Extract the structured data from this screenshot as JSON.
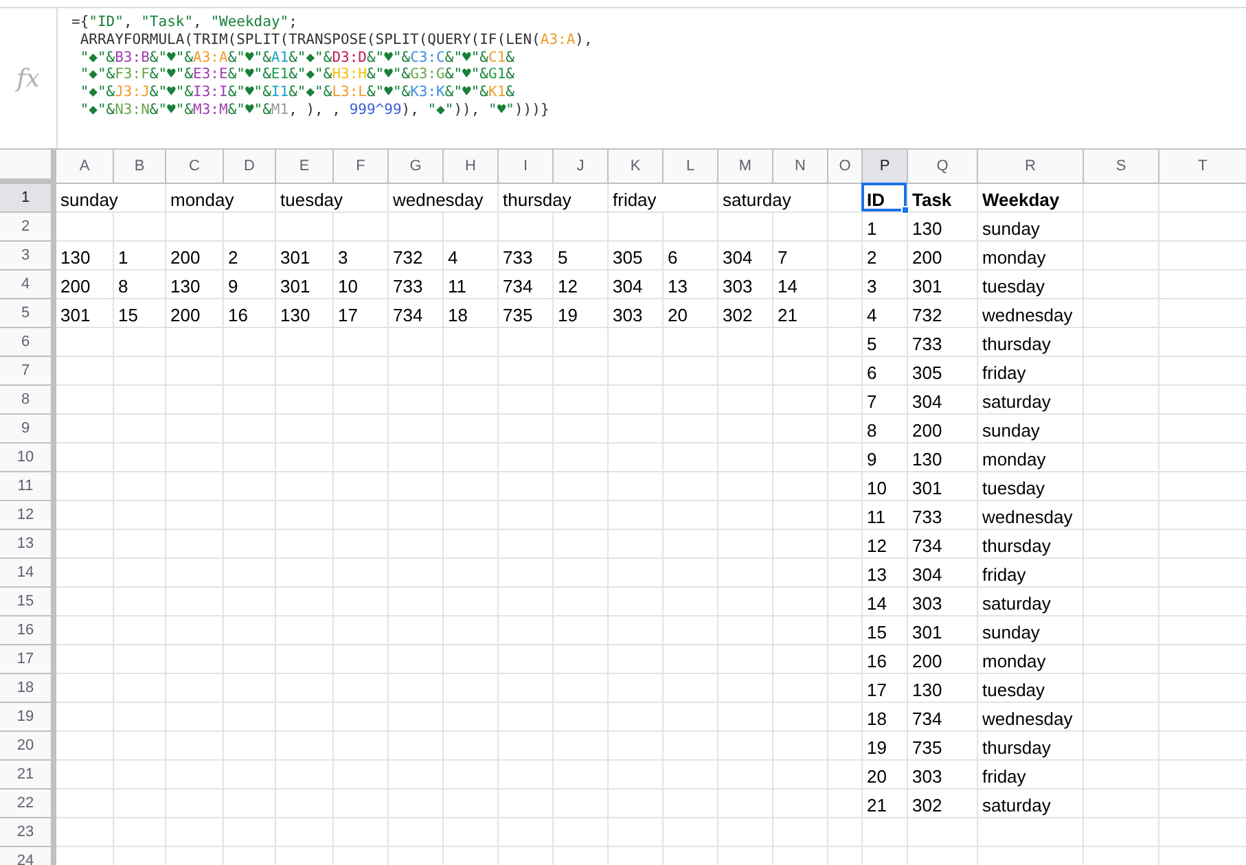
{
  "formula_bar": {
    "icon_label": "fx",
    "lines": [
      [
        {
          "text": "={",
          "color": "#333333"
        },
        {
          "text": "\"ID\"",
          "color": "#188038"
        },
        {
          "text": ", ",
          "color": "#333333"
        },
        {
          "text": "\"Task\"",
          "color": "#188038"
        },
        {
          "text": ", ",
          "color": "#333333"
        },
        {
          "text": "\"Weekday\"",
          "color": "#188038"
        },
        {
          "text": ";",
          "color": "#333333"
        }
      ],
      [
        {
          "text": " ARRAYFORMULA(TRIM(SPLIT(TRANSPOSE(SPLIT(QUERY(IF(LEN(",
          "color": "#333333"
        },
        {
          "text": "A3:A",
          "color": "#f09d2a"
        },
        {
          "text": "),",
          "color": "#333333"
        }
      ],
      [
        {
          "text": " \"◆\"&",
          "color": "#188038"
        },
        {
          "text": "B3:B",
          "color": "#a142b4"
        },
        {
          "text": "&\"♥\"&",
          "color": "#188038"
        },
        {
          "text": "A3:A",
          "color": "#f09d2a"
        },
        {
          "text": "&\"♥\"&",
          "color": "#188038"
        },
        {
          "text": "A1",
          "color": "#1aa3c9"
        },
        {
          "text": "&\"◆\"&",
          "color": "#188038"
        },
        {
          "text": "D3:D",
          "color": "#c2185b"
        },
        {
          "text": "&\"♥\"&",
          "color": "#188038"
        },
        {
          "text": "C3:C",
          "color": "#3b8ee0"
        },
        {
          "text": "&\"♥\"&",
          "color": "#188038"
        },
        {
          "text": "C1",
          "color": "#f09d2a"
        },
        {
          "text": "&",
          "color": "#188038"
        }
      ],
      [
        {
          "text": " \"◆\"&",
          "color": "#188038"
        },
        {
          "text": "F3:F",
          "color": "#6aa84f"
        },
        {
          "text": "&\"♥\"&",
          "color": "#188038"
        },
        {
          "text": "E3:E",
          "color": "#a142b4"
        },
        {
          "text": "&\"♥\"&",
          "color": "#188038"
        },
        {
          "text": "E1",
          "color": "#1e9e4a"
        },
        {
          "text": "&\"◆\"&",
          "color": "#188038"
        },
        {
          "text": "H3:H",
          "color": "#f4c20d"
        },
        {
          "text": "&\"♥\"&",
          "color": "#188038"
        },
        {
          "text": "G3:G",
          "color": "#6aa84f"
        },
        {
          "text": "&\"♥\"&",
          "color": "#188038"
        },
        {
          "text": "G1",
          "color": "#1e9e4a"
        },
        {
          "text": "&",
          "color": "#188038"
        }
      ],
      [
        {
          "text": " \"◆\"&",
          "color": "#188038"
        },
        {
          "text": "J3:J",
          "color": "#f09d2a"
        },
        {
          "text": "&\"♥\"&",
          "color": "#188038"
        },
        {
          "text": "I3:I",
          "color": "#a142b4"
        },
        {
          "text": "&\"♥\"&",
          "color": "#188038"
        },
        {
          "text": "I1",
          "color": "#1aa3c9"
        },
        {
          "text": "&\"◆\"&",
          "color": "#188038"
        },
        {
          "text": "L3:L",
          "color": "#f09d2a"
        },
        {
          "text": "&\"♥\"&",
          "color": "#188038"
        },
        {
          "text": "K3:K",
          "color": "#3b8ee0"
        },
        {
          "text": "&\"♥\"&",
          "color": "#188038"
        },
        {
          "text": "K1",
          "color": "#f09d2a"
        },
        {
          "text": "&",
          "color": "#188038"
        }
      ],
      [
        {
          "text": " \"◆\"&",
          "color": "#188038"
        },
        {
          "text": "N3:N",
          "color": "#6aa84f"
        },
        {
          "text": "&\"♥\"&",
          "color": "#188038"
        },
        {
          "text": "M3:M",
          "color": "#a142b4"
        },
        {
          "text": "&\"♥\"&",
          "color": "#188038"
        },
        {
          "text": "M1",
          "color": "#999999"
        },
        {
          "text": ", ), , ",
          "color": "#333333"
        },
        {
          "text": "999^99",
          "color": "#3b5fd6"
        },
        {
          "text": "), ",
          "color": "#333333"
        },
        {
          "text": "\"◆\"",
          "color": "#188038"
        },
        {
          "text": ")), ",
          "color": "#333333"
        },
        {
          "text": "\"♥\"",
          "color": "#188038"
        },
        {
          "text": ")))}",
          "color": "#333333"
        }
      ]
    ]
  },
  "columns": [
    {
      "label": "A",
      "selected": false
    },
    {
      "label": "B",
      "selected": false
    },
    {
      "label": "C",
      "selected": false
    },
    {
      "label": "D",
      "selected": false
    },
    {
      "label": "E",
      "selected": false
    },
    {
      "label": "F",
      "selected": false
    },
    {
      "label": "G",
      "selected": false
    },
    {
      "label": "H",
      "selected": false
    },
    {
      "label": "I",
      "selected": false
    },
    {
      "label": "J",
      "selected": false
    },
    {
      "label": "K",
      "selected": false
    },
    {
      "label": "L",
      "selected": false
    },
    {
      "label": "M",
      "selected": false
    },
    {
      "label": "N",
      "selected": false
    },
    {
      "label": "O",
      "selected": false
    },
    {
      "label": "P",
      "selected": true
    },
    {
      "label": "Q",
      "selected": false
    },
    {
      "label": "R",
      "selected": false
    },
    {
      "label": "S",
      "selected": false
    },
    {
      "label": "T",
      "selected": false
    }
  ],
  "rows": [
    {
      "number": "1",
      "selected": true,
      "cells": [
        "sunday",
        null,
        "monday",
        null,
        "tuesday",
        null,
        "wednesday",
        null,
        "thursday",
        null,
        "friday",
        null,
        "saturday",
        null,
        null,
        {
          "text": "ID",
          "bold": true,
          "selected": true
        },
        {
          "text": "Task",
          "bold": true,
          "selected": false
        },
        {
          "text": "Weekday",
          "bold": true,
          "selected": false
        },
        null,
        null
      ]
    },
    {
      "number": "2",
      "selected": false,
      "cells": [
        null,
        null,
        null,
        null,
        null,
        null,
        null,
        null,
        null,
        null,
        null,
        null,
        null,
        null,
        null,
        "1",
        "130",
        "sunday",
        null,
        null
      ]
    },
    {
      "number": "3",
      "selected": false,
      "cells": [
        "130",
        "1",
        "200",
        "2",
        "301",
        "3",
        "732",
        "4",
        "733",
        "5",
        "305",
        "6",
        "304",
        "7",
        null,
        "2",
        "200",
        "monday",
        null,
        null
      ]
    },
    {
      "number": "4",
      "selected": false,
      "cells": [
        "200",
        "8",
        "130",
        "9",
        "301",
        "10",
        "733",
        "11",
        "734",
        "12",
        "304",
        "13",
        "303",
        "14",
        null,
        "3",
        "301",
        "tuesday",
        null,
        null
      ]
    },
    {
      "number": "5",
      "selected": false,
      "cells": [
        "301",
        "15",
        "200",
        "16",
        "130",
        "17",
        "734",
        "18",
        "735",
        "19",
        "303",
        "20",
        "302",
        "21",
        null,
        "4",
        "732",
        "wednesday",
        null,
        null
      ]
    },
    {
      "number": "6",
      "selected": false,
      "cells": [
        null,
        null,
        null,
        null,
        null,
        null,
        null,
        null,
        null,
        null,
        null,
        null,
        null,
        null,
        null,
        "5",
        "733",
        "thursday",
        null,
        null
      ]
    },
    {
      "number": "7",
      "selected": false,
      "cells": [
        null,
        null,
        null,
        null,
        null,
        null,
        null,
        null,
        null,
        null,
        null,
        null,
        null,
        null,
        null,
        "6",
        "305",
        "friday",
        null,
        null
      ]
    },
    {
      "number": "8",
      "selected": false,
      "cells": [
        null,
        null,
        null,
        null,
        null,
        null,
        null,
        null,
        null,
        null,
        null,
        null,
        null,
        null,
        null,
        "7",
        "304",
        "saturday",
        null,
        null
      ]
    },
    {
      "number": "9",
      "selected": false,
      "cells": [
        null,
        null,
        null,
        null,
        null,
        null,
        null,
        null,
        null,
        null,
        null,
        null,
        null,
        null,
        null,
        "8",
        "200",
        "sunday",
        null,
        null
      ]
    },
    {
      "number": "10",
      "selected": false,
      "cells": [
        null,
        null,
        null,
        null,
        null,
        null,
        null,
        null,
        null,
        null,
        null,
        null,
        null,
        null,
        null,
        "9",
        "130",
        "monday",
        null,
        null
      ]
    },
    {
      "number": "11",
      "selected": false,
      "cells": [
        null,
        null,
        null,
        null,
        null,
        null,
        null,
        null,
        null,
        null,
        null,
        null,
        null,
        null,
        null,
        "10",
        "301",
        "tuesday",
        null,
        null
      ]
    },
    {
      "number": "12",
      "selected": false,
      "cells": [
        null,
        null,
        null,
        null,
        null,
        null,
        null,
        null,
        null,
        null,
        null,
        null,
        null,
        null,
        null,
        "11",
        "733",
        "wednesday",
        null,
        null
      ]
    },
    {
      "number": "13",
      "selected": false,
      "cells": [
        null,
        null,
        null,
        null,
        null,
        null,
        null,
        null,
        null,
        null,
        null,
        null,
        null,
        null,
        null,
        "12",
        "734",
        "thursday",
        null,
        null
      ]
    },
    {
      "number": "14",
      "selected": false,
      "cells": [
        null,
        null,
        null,
        null,
        null,
        null,
        null,
        null,
        null,
        null,
        null,
        null,
        null,
        null,
        null,
        "13",
        "304",
        "friday",
        null,
        null
      ]
    },
    {
      "number": "15",
      "selected": false,
      "cells": [
        null,
        null,
        null,
        null,
        null,
        null,
        null,
        null,
        null,
        null,
        null,
        null,
        null,
        null,
        null,
        "14",
        "303",
        "saturday",
        null,
        null
      ]
    },
    {
      "number": "16",
      "selected": false,
      "cells": [
        null,
        null,
        null,
        null,
        null,
        null,
        null,
        null,
        null,
        null,
        null,
        null,
        null,
        null,
        null,
        "15",
        "301",
        "sunday",
        null,
        null
      ]
    },
    {
      "number": "17",
      "selected": false,
      "cells": [
        null,
        null,
        null,
        null,
        null,
        null,
        null,
        null,
        null,
        null,
        null,
        null,
        null,
        null,
        null,
        "16",
        "200",
        "monday",
        null,
        null
      ]
    },
    {
      "number": "18",
      "selected": false,
      "cells": [
        null,
        null,
        null,
        null,
        null,
        null,
        null,
        null,
        null,
        null,
        null,
        null,
        null,
        null,
        null,
        "17",
        "130",
        "tuesday",
        null,
        null
      ]
    },
    {
      "number": "19",
      "selected": false,
      "cells": [
        null,
        null,
        null,
        null,
        null,
        null,
        null,
        null,
        null,
        null,
        null,
        null,
        null,
        null,
        null,
        "18",
        "734",
        "wednesday",
        null,
        null
      ]
    },
    {
      "number": "20",
      "selected": false,
      "cells": [
        null,
        null,
        null,
        null,
        null,
        null,
        null,
        null,
        null,
        null,
        null,
        null,
        null,
        null,
        null,
        "19",
        "735",
        "thursday",
        null,
        null
      ]
    },
    {
      "number": "21",
      "selected": false,
      "cells": [
        null,
        null,
        null,
        null,
        null,
        null,
        null,
        null,
        null,
        null,
        null,
        null,
        null,
        null,
        null,
        "20",
        "303",
        "friday",
        null,
        null
      ]
    },
    {
      "number": "22",
      "selected": false,
      "cells": [
        null,
        null,
        null,
        null,
        null,
        null,
        null,
        null,
        null,
        null,
        null,
        null,
        null,
        null,
        null,
        "21",
        "302",
        "saturday",
        null,
        null
      ]
    },
    {
      "number": "23",
      "selected": false,
      "cells": [
        null,
        null,
        null,
        null,
        null,
        null,
        null,
        null,
        null,
        null,
        null,
        null,
        null,
        null,
        null,
        null,
        null,
        null,
        null,
        null
      ]
    },
    {
      "number": "24",
      "selected": false,
      "cells": [
        null,
        null,
        null,
        null,
        null,
        null,
        null,
        null,
        null,
        null,
        null,
        null,
        null,
        null,
        null,
        null,
        null,
        null,
        null,
        null
      ]
    }
  ]
}
